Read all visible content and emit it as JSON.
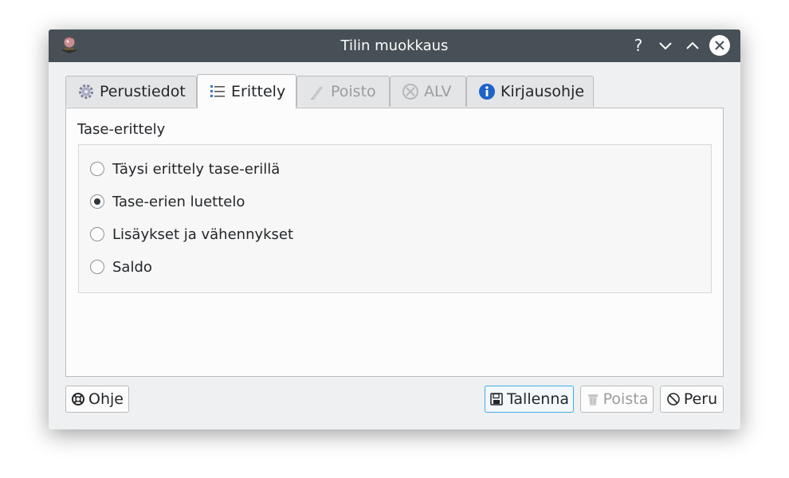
{
  "window": {
    "title": "Tilin muokkaus",
    "help_glyph": "?",
    "minimize_glyph": "⌄",
    "maximize_glyph": "⌃",
    "close_glyph": "✕"
  },
  "tabs": [
    {
      "label": "Perustiedot",
      "icon": "gear-icon",
      "state": "normal"
    },
    {
      "label": "Erittely",
      "icon": "list-icon",
      "state": "active"
    },
    {
      "label": "Poisto",
      "icon": "pencil-icon",
      "state": "disabled"
    },
    {
      "label": "ALV",
      "icon": "tax-icon",
      "state": "disabled"
    },
    {
      "label": "Kirjausohje",
      "icon": "info-icon",
      "state": "normal"
    }
  ],
  "group": {
    "title": "Tase-erittely",
    "options": [
      {
        "label": "Täysi erittely tase-erillä",
        "checked": false
      },
      {
        "label": "Tase-erien luettelo",
        "checked": true
      },
      {
        "label": "Lisäykset ja vähennykset",
        "checked": false
      },
      {
        "label": "Saldo",
        "checked": false
      }
    ]
  },
  "buttons": {
    "help": "Ohje",
    "save": "Tallenna",
    "delete": "Poista",
    "cancel": "Peru"
  },
  "colors": {
    "titlebar": "#475057",
    "focus_accent": "#3daee9"
  }
}
